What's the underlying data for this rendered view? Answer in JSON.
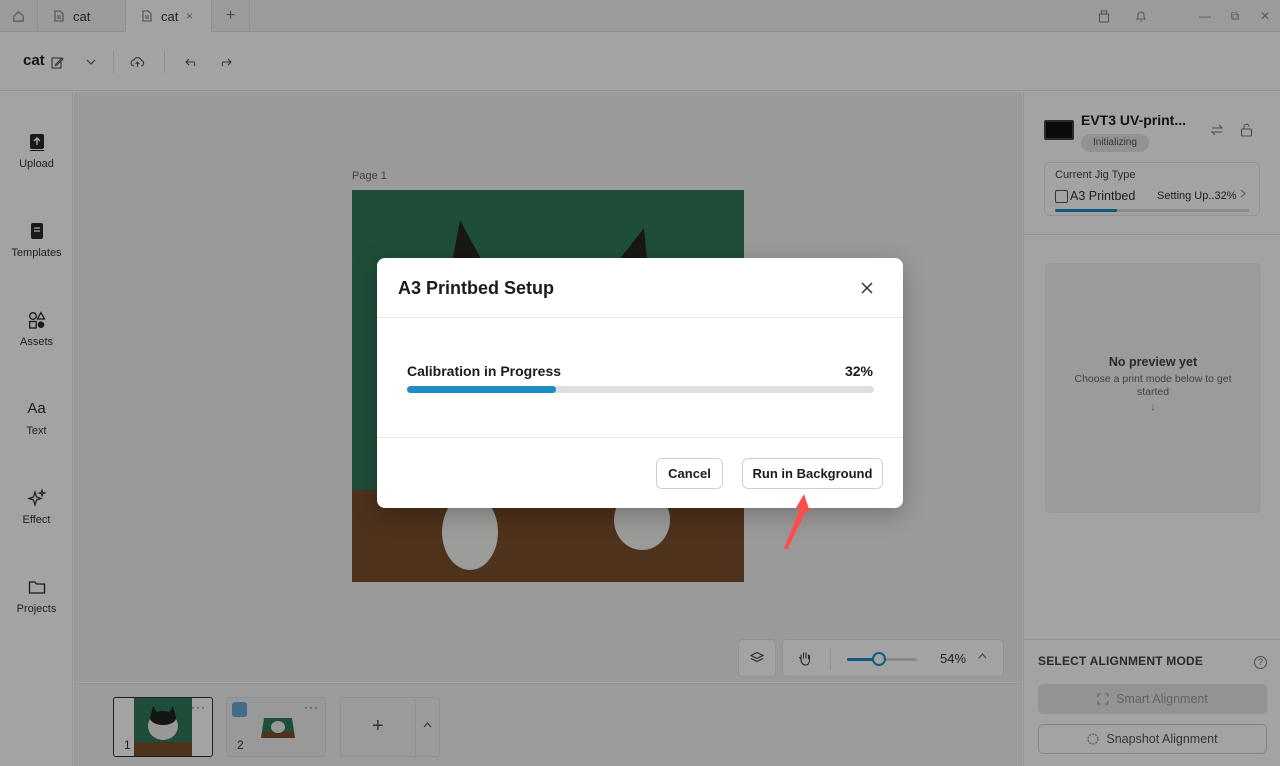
{
  "tabs": [
    {
      "label": "cat"
    },
    {
      "label": "cat",
      "close": "×"
    }
  ],
  "tab_add": "+",
  "window": {
    "minimize": "—",
    "restore": "⧉",
    "close": "✕"
  },
  "toolbar": {
    "doc_title": "cat"
  },
  "leftnav": [
    {
      "label": "Upload",
      "icon": "upload-icon"
    },
    {
      "label": "Templates",
      "icon": "templates-icon"
    },
    {
      "label": "Assets",
      "icon": "assets-icon"
    },
    {
      "label": "Text",
      "icon": "text-icon",
      "glyph": "Aa"
    },
    {
      "label": "Effect",
      "icon": "effect-icon"
    },
    {
      "label": "Projects",
      "icon": "folder-icon"
    }
  ],
  "canvas": {
    "page_label": "Page 1"
  },
  "zoom": {
    "value_text": "54%",
    "level": 0.45
  },
  "pages": [
    {
      "num": "1",
      "more": "···"
    },
    {
      "num": "2",
      "more": "···"
    }
  ],
  "add_page": {
    "plus": "+"
  },
  "printer": {
    "name": "EVT3 UV-print...",
    "status": "Initializing",
    "jig_title": "Current Jig Type",
    "jig_name": "A3 Printbed",
    "jig_status": "Setting Up..32%",
    "jig_progress": 0.32
  },
  "preview": {
    "title": "No preview yet",
    "subtitle": "Choose a print mode below to get started",
    "arrow": "↓"
  },
  "alignment": {
    "title": "SELECT ALIGNMENT MODE",
    "help": "?",
    "smart_label": "Smart Alignment",
    "snapshot_label": "Snapshot Alignment"
  },
  "dialog": {
    "title": "A3 Printbed Setup",
    "progress_label": "Calibration in Progress",
    "progress_pct": "32%",
    "progress": 0.32,
    "cancel_label": "Cancel",
    "run_label": "Run in Background"
  },
  "colors": {
    "accent": "#1f8cc3",
    "pointer": "#ff4d4f"
  }
}
